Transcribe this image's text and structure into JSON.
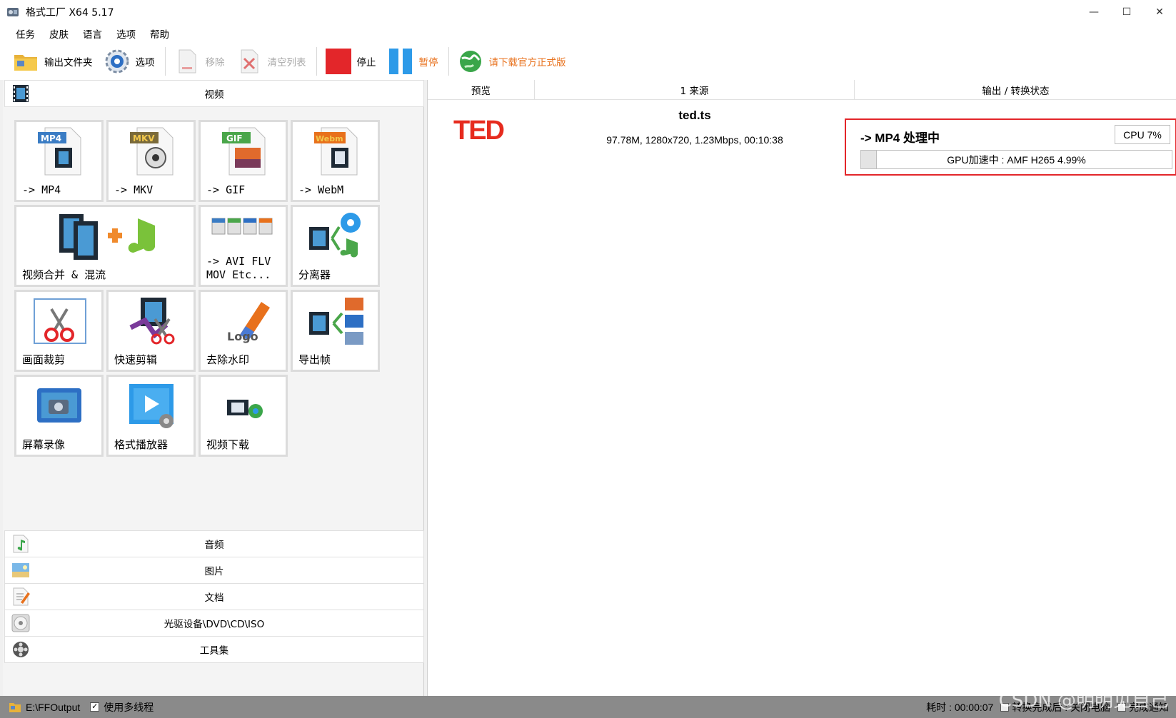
{
  "window": {
    "title": "格式工厂 X64 5.17"
  },
  "window_controls": {
    "minimize": "—",
    "maximize": "☐",
    "close": "✕"
  },
  "menu": [
    {
      "label": "任务"
    },
    {
      "label": "皮肤"
    },
    {
      "label": "语言"
    },
    {
      "label": "选项"
    },
    {
      "label": "帮助"
    }
  ],
  "toolbar": {
    "output_folder": "输出文件夹",
    "options": "选项",
    "remove": "移除",
    "clear_list": "清空列表",
    "stop": "停止",
    "pause": "暂停",
    "download": "请下载官方正式版"
  },
  "colors": {
    "accent_orange": "#e8711c",
    "stop_red": "#e3262a",
    "pause_blue": "#2d9ae8",
    "ted_red": "#e62b1e",
    "highlight_red": "#e3262a"
  },
  "categories": {
    "video": "视频",
    "audio": "音频",
    "image": "图片",
    "document": "文档",
    "disc": "光驱设备\\DVD\\CD\\ISO",
    "tools": "工具集"
  },
  "tiles": [
    {
      "label": "-> MP4",
      "badge": "MP4",
      "badge_color": "#3a7cc4"
    },
    {
      "label": "-> MKV",
      "badge": "MKV",
      "badge_color": "#7a6a3a"
    },
    {
      "label": "-> GIF",
      "badge": "GIF",
      "badge_color": "#4aa64a"
    },
    {
      "label": "-> WebM",
      "badge": "Webm",
      "badge_color": "#e8711c"
    },
    {
      "label": "视频合并 & 混流"
    },
    {
      "label": "-> AVI FLV\nMOV Etc..."
    },
    {
      "label": "分离器"
    },
    {
      "label": "画面裁剪"
    },
    {
      "label": "快速剪辑"
    },
    {
      "label": "去除水印"
    },
    {
      "label": "导出帧"
    },
    {
      "label": "屏幕录像"
    },
    {
      "label": "格式播放器"
    },
    {
      "label": "视频下载"
    }
  ],
  "table": {
    "headers": {
      "preview": "预览",
      "source": "1 来源",
      "output": "输出 / 转换状态"
    },
    "rows": [
      {
        "preview_logo": "TED",
        "source_name": "ted.ts",
        "source_meta": "97.78M, 1280x720, 1.23Mbps, 00:10:38",
        "status_title": "-> MP4 处理中",
        "cpu": "CPU 7%",
        "progress_text": "GPU加速中 : AMF H265 4.99%",
        "progress_fraction": 0.0499
      }
    ]
  },
  "statusbar": {
    "output_path": "E:\\FFOutput",
    "multithread": "使用多线程",
    "elapsed": "耗时 : 00:00:07",
    "after_convert": "转换完成后 : 关闭电脑",
    "notify": "完成通知",
    "watermark": "CSDN @明明见自己"
  }
}
